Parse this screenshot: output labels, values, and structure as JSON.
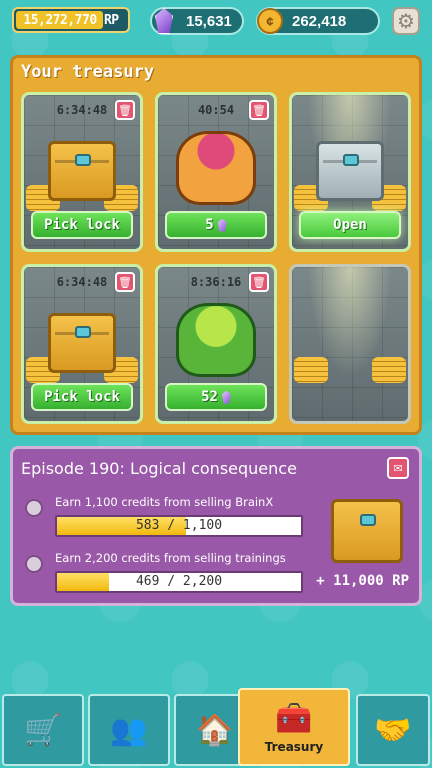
{
  "topbar": {
    "rp_value": "15,272,770 RP",
    "gems": "15,631",
    "coins": "262,418",
    "rp_fill_fraction": 0.8
  },
  "treasury": {
    "title": "Your treasury",
    "slots": [
      {
        "timer": "6:34:48",
        "action_label": "Pick lock",
        "content": "golden-chest"
      },
      {
        "timer": "40:54",
        "action_label": "5",
        "content": "orange-octopus-creature"
      },
      {
        "timer": "",
        "action_label": "Open",
        "content": "silver-chest"
      },
      {
        "timer": "6:34:48",
        "action_label": "Pick lock",
        "content": "golden-chest"
      },
      {
        "timer": "8:36:16",
        "action_label": "52",
        "content": "green-tentacle-creature"
      },
      {
        "timer": "",
        "action_label": "",
        "content": "empty"
      }
    ]
  },
  "episode": {
    "title": "Episode 190: Logical consequence",
    "tasks": [
      {
        "desc": "Earn 1,100 credits from selling BrainX",
        "progress_text": "583 / 1,100",
        "progress": 0.53
      },
      {
        "desc": "Earn 2,200 credits from selling trainings",
        "progress_text": "469 / 2,200",
        "progress": 0.213
      }
    ],
    "reward": "+ 11,000 RP"
  },
  "nav": {
    "items": [
      {
        "label": "",
        "icon": "cart-icon"
      },
      {
        "label": "",
        "icon": "people-icon"
      },
      {
        "label": "",
        "icon": "house-icon"
      },
      {
        "label": "Treasury",
        "icon": "chest-icon"
      },
      {
        "label": "",
        "icon": "handshake-icon"
      }
    ],
    "active_index": 3
  },
  "colors": {
    "background": "#42c6c2",
    "treasury_panel": "#e8ac33",
    "episode_panel": "#9a58a8",
    "action_green": "#35b12f",
    "accent_gold": "#f2b63a"
  }
}
